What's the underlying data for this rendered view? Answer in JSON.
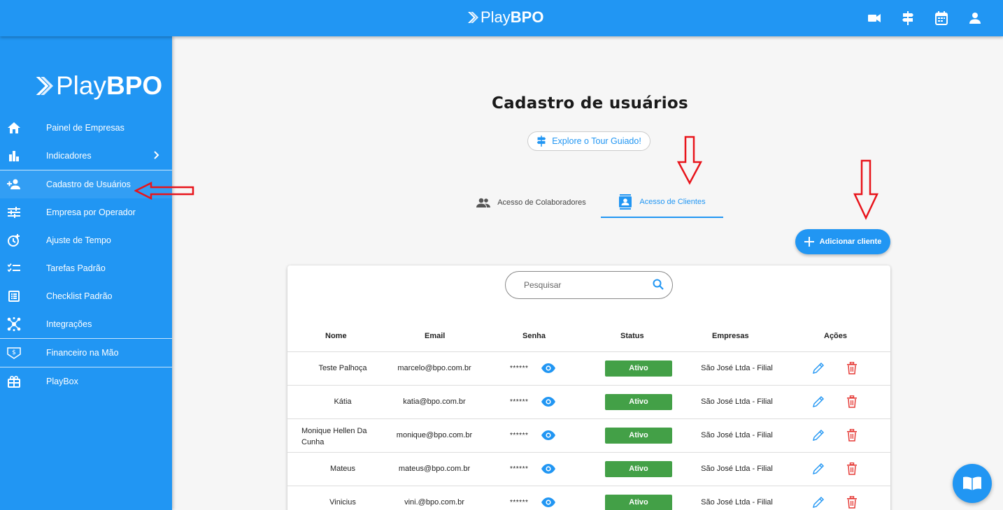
{
  "brand": {
    "play": "Play",
    "bpo": "BPO"
  },
  "topbar": {
    "icons": [
      "video-camera-icon",
      "signpost-icon",
      "calendar-icon",
      "user-icon"
    ]
  },
  "sidebar": {
    "items": [
      {
        "label": "Painel de Empresas",
        "icon": "home-icon"
      },
      {
        "label": "Indicadores",
        "icon": "bar-chart-icon"
      },
      {
        "label": "Cadastro de Usuários",
        "icon": "add-user-icon"
      },
      {
        "label": "Empresa por Operador",
        "icon": "sliders-icon"
      },
      {
        "label": "Ajuste de Tempo",
        "icon": "clock-plus-icon"
      },
      {
        "label": "Tarefas Padrão",
        "icon": "checklist-icon"
      },
      {
        "label": "Checklist Padrão",
        "icon": "list-box-icon"
      },
      {
        "label": "Integrações",
        "icon": "hub-icon"
      },
      {
        "label": "Financeiro na Mão",
        "icon": "money-icon"
      },
      {
        "label": "PlayBox",
        "icon": "gift-box-icon"
      }
    ]
  },
  "main": {
    "title": "Cadastro de usuários",
    "tour_label": "Explore o Tour Guiado!",
    "tabs": [
      {
        "label": "Acesso de Colaboradores"
      },
      {
        "label": "Acesso de Clientes"
      }
    ],
    "add_label": "Adicionar cliente",
    "search_placeholder": "Pesquisar",
    "columns": [
      "Nome",
      "Email",
      "Senha",
      "Status",
      "Empresas",
      "Ações"
    ],
    "rows": [
      {
        "nome": "Teste Palhoça",
        "email": "marcelo@bpo.com.br",
        "senha": "******",
        "status": "Ativo",
        "empresa": "São José Ltda - Filial"
      },
      {
        "nome": "Kátia",
        "email": "katia@bpo.com.br",
        "senha": "******",
        "status": "Ativo",
        "empresa": "São José Ltda - Filial"
      },
      {
        "nome": "Monique Hellen Da Cunha",
        "email": "monique@bpo.com.br",
        "senha": "******",
        "status": "Ativo",
        "empresa": "São José Ltda - Filial"
      },
      {
        "nome": "Mateus",
        "email": "mateus@bpo.com.br",
        "senha": "******",
        "status": "Ativo",
        "empresa": "São José Ltda - Filial"
      },
      {
        "nome": "Vinicius",
        "email": "vini.@bpo.com.br",
        "senha": "******",
        "status": "Ativo",
        "empresa": "São José Ltda - Filial"
      }
    ]
  },
  "colors": {
    "primary": "#2196f3",
    "active": "#43a047",
    "danger": "#e53935",
    "annotation": "#e8141b"
  }
}
